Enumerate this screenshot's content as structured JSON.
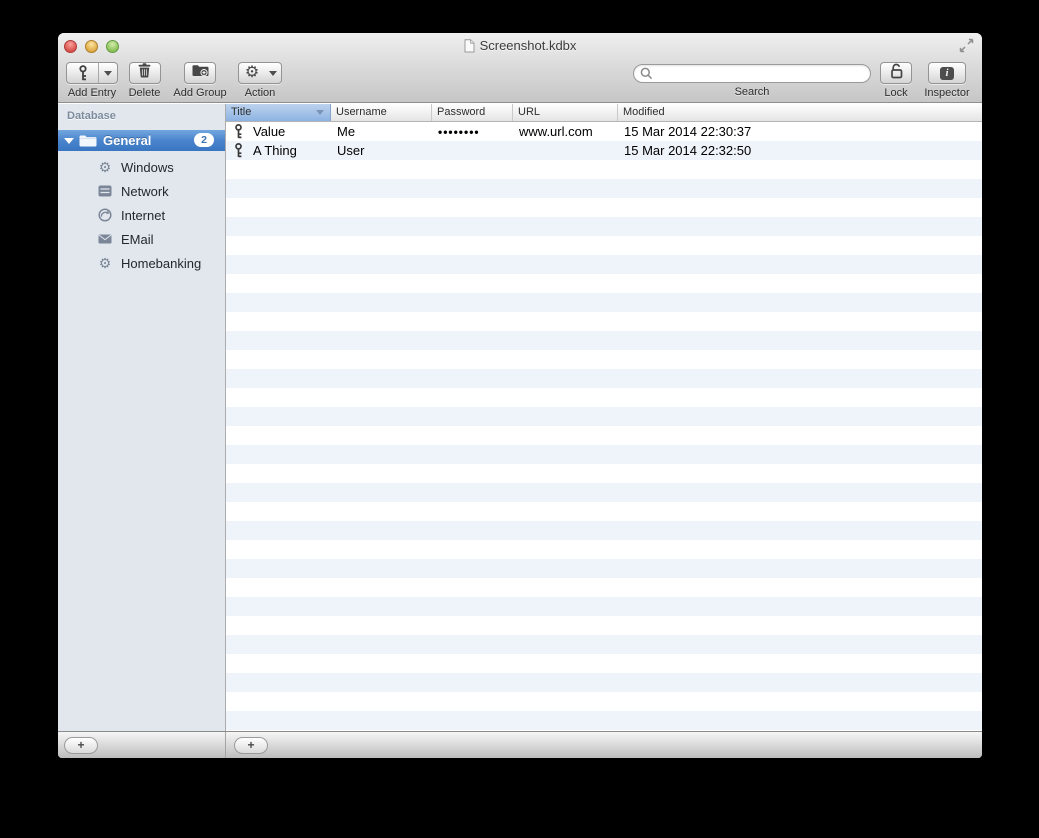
{
  "window": {
    "title": "Screenshot.kdbx"
  },
  "toolbar": {
    "buttons": [
      {
        "label": "Add Entry",
        "icon": "key-icon",
        "has_dropdown": true
      },
      {
        "label": "Delete",
        "icon": "trash-icon",
        "has_dropdown": false
      },
      {
        "label": "Add Group",
        "icon": "folder-plus-icon",
        "has_dropdown": false
      },
      {
        "label": "Action",
        "icon": "gear-icon",
        "has_dropdown": true
      }
    ],
    "search": {
      "label": "Search",
      "value": "",
      "icon": "search-icon"
    },
    "right_buttons": [
      {
        "label": "Lock",
        "icon": "padlock-open-icon"
      },
      {
        "label": "Inspector",
        "icon": "info-icon"
      }
    ]
  },
  "icons": {
    "gear_glyph": "⚙"
  },
  "sidebar": {
    "header": "Database",
    "group": {
      "label": "General",
      "badge": "2",
      "icon": "folder-icon",
      "expanded": true
    },
    "items": [
      {
        "label": "Windows",
        "icon": "gear-icon"
      },
      {
        "label": "Network",
        "icon": "server-icon"
      },
      {
        "label": "Internet",
        "icon": "globe-icon"
      },
      {
        "label": "EMail",
        "icon": "envelope-icon"
      },
      {
        "label": "Homebanking",
        "icon": "gear-icon"
      }
    ]
  },
  "table": {
    "columns": [
      {
        "label": "Title",
        "sorted": "desc"
      },
      {
        "label": "Username"
      },
      {
        "label": "Password"
      },
      {
        "label": "URL"
      },
      {
        "label": "Modified"
      }
    ],
    "rows": [
      {
        "icon": "key-icon",
        "title": "Value",
        "username": "Me",
        "password": "••••••••",
        "url": "www.url.com",
        "modified": "15 Mar 2014 22:30:37"
      },
      {
        "icon": "key-icon",
        "title": "A Thing",
        "username": "User",
        "password": "",
        "url": "",
        "modified": "15 Mar 2014 22:32:50"
      }
    ]
  },
  "bottombar": {
    "sidebar_add": "+",
    "table_add": "+"
  },
  "colors": {
    "selection_blue": "#3a76c1",
    "sorted_header_blue": "#8db3e2",
    "row_stripe": "#eff3fa",
    "sidebar_bg": "#e2e7ee"
  }
}
